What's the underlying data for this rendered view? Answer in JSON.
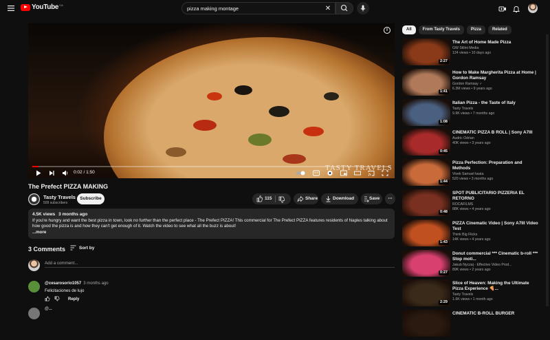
{
  "header": {
    "logo_text": "YouTube",
    "country_code": "CA",
    "search_value": "pizza making montage",
    "search_placeholder": "Search"
  },
  "player": {
    "current_time": "0:02",
    "duration": "1:50",
    "time_separator": "/",
    "progress_fraction": 0.018,
    "watermark": "TASTY TRAVELS"
  },
  "video": {
    "title": "The Prefect PIZZA MAKING",
    "channel": "Tasty Travels",
    "subscribers": "509 subscribers",
    "subscribe_label": "Subscribe",
    "likes": "115",
    "share_label": "Share",
    "download_label": "Download",
    "save_label": "Save"
  },
  "description": {
    "views": "4.5K views",
    "age": "3 months ago",
    "text": "If you're hungry and want the best pizza in town, look no further than the perfect place - The Prefect PIZZA! This commercial for The Prefect PIZZA features residents of Naples talking about how good the pizza is and how they can't get enough of it. Watch the video to see what all the buzz is about!",
    "more_label": "...more"
  },
  "comments": {
    "count_label": "3 Comments",
    "sort_label": "Sort by",
    "add_placeholder": "Add a comment...",
    "items": [
      {
        "author": "@cesarosorio1057",
        "time": "3 months ago",
        "text": "Felicitaciones de lujo",
        "reply_label": "Reply"
      },
      {
        "author": "@..."
      }
    ]
  },
  "filters": [
    "All",
    "From Tasty Travels",
    "Pizza",
    "Related"
  ],
  "recommendations": [
    {
      "title": "The Art of Home Made Pizza",
      "channel": "GW Stilini Media",
      "views": "124 views",
      "age": "10 days ago",
      "duration": "2:27",
      "thumb": "#8a3a18"
    },
    {
      "title": "How to Make Margherita Pizza at Home | Gordon Ramsay",
      "channel": "Gordon Ramsay ✓",
      "views": "6.3M views",
      "age": "9 years ago",
      "duration": "1:41",
      "thumb": "#b07a5a"
    },
    {
      "title": "Italian Pizza - the Taste of Italy",
      "channel": "Tasty Travels",
      "views": "9.9K views",
      "age": "7 months ago",
      "duration": "1:08",
      "thumb": "#4a6080"
    },
    {
      "title": "CINEMATIC PIZZA B ROLL | Sony A7III",
      "channel": "Audric Odrian",
      "views": "40K views",
      "age": "3 years ago",
      "duration": "0:45",
      "thumb": "#a82a2a"
    },
    {
      "title": "Pizza Perfection: Preparation and Methods",
      "channel": "Vivek Samuel Iwata",
      "views": "520 views",
      "age": "3 months ago",
      "duration": "1:44",
      "thumb": "#c86a3a"
    },
    {
      "title": "SPOT PUBLICITARIO PIZZERIA EL RETORNO",
      "channel": "ROCAFILMS",
      "views": "88K views",
      "age": "4 years ago",
      "duration": "0:48",
      "thumb": "#7a3020"
    },
    {
      "title": "PIZZA Cinematic Video | Sony A7III Video Test",
      "channel": "Think Big Flicks",
      "views": "14K views",
      "age": "4 years ago",
      "duration": "1:43",
      "thumb": "#c05020"
    },
    {
      "title": "Donut commercial *** Cinematic b-roll *** Stop moti...",
      "channel": "Jakub Nyczaj - Effective Video Prod...",
      "views": "89K views",
      "age": "2 years ago",
      "duration": "0:27",
      "thumb": "#d84070"
    },
    {
      "title": "Slice of Heaven: Making the Ultimate Pizza Experience 🍕...",
      "channel": "Tasty Travels",
      "views": "1.6K views",
      "age": "1 month ago",
      "duration": "2:29",
      "thumb": "#3a2a1a"
    },
    {
      "title": "CINEMATIC B-ROLL BURGER",
      "channel": "",
      "views": "",
      "age": "",
      "duration": "",
      "thumb": "#2a1a10"
    }
  ],
  "colors": {
    "accent": "#ff0000",
    "background": "#0f0f0f",
    "surface": "#272727"
  }
}
